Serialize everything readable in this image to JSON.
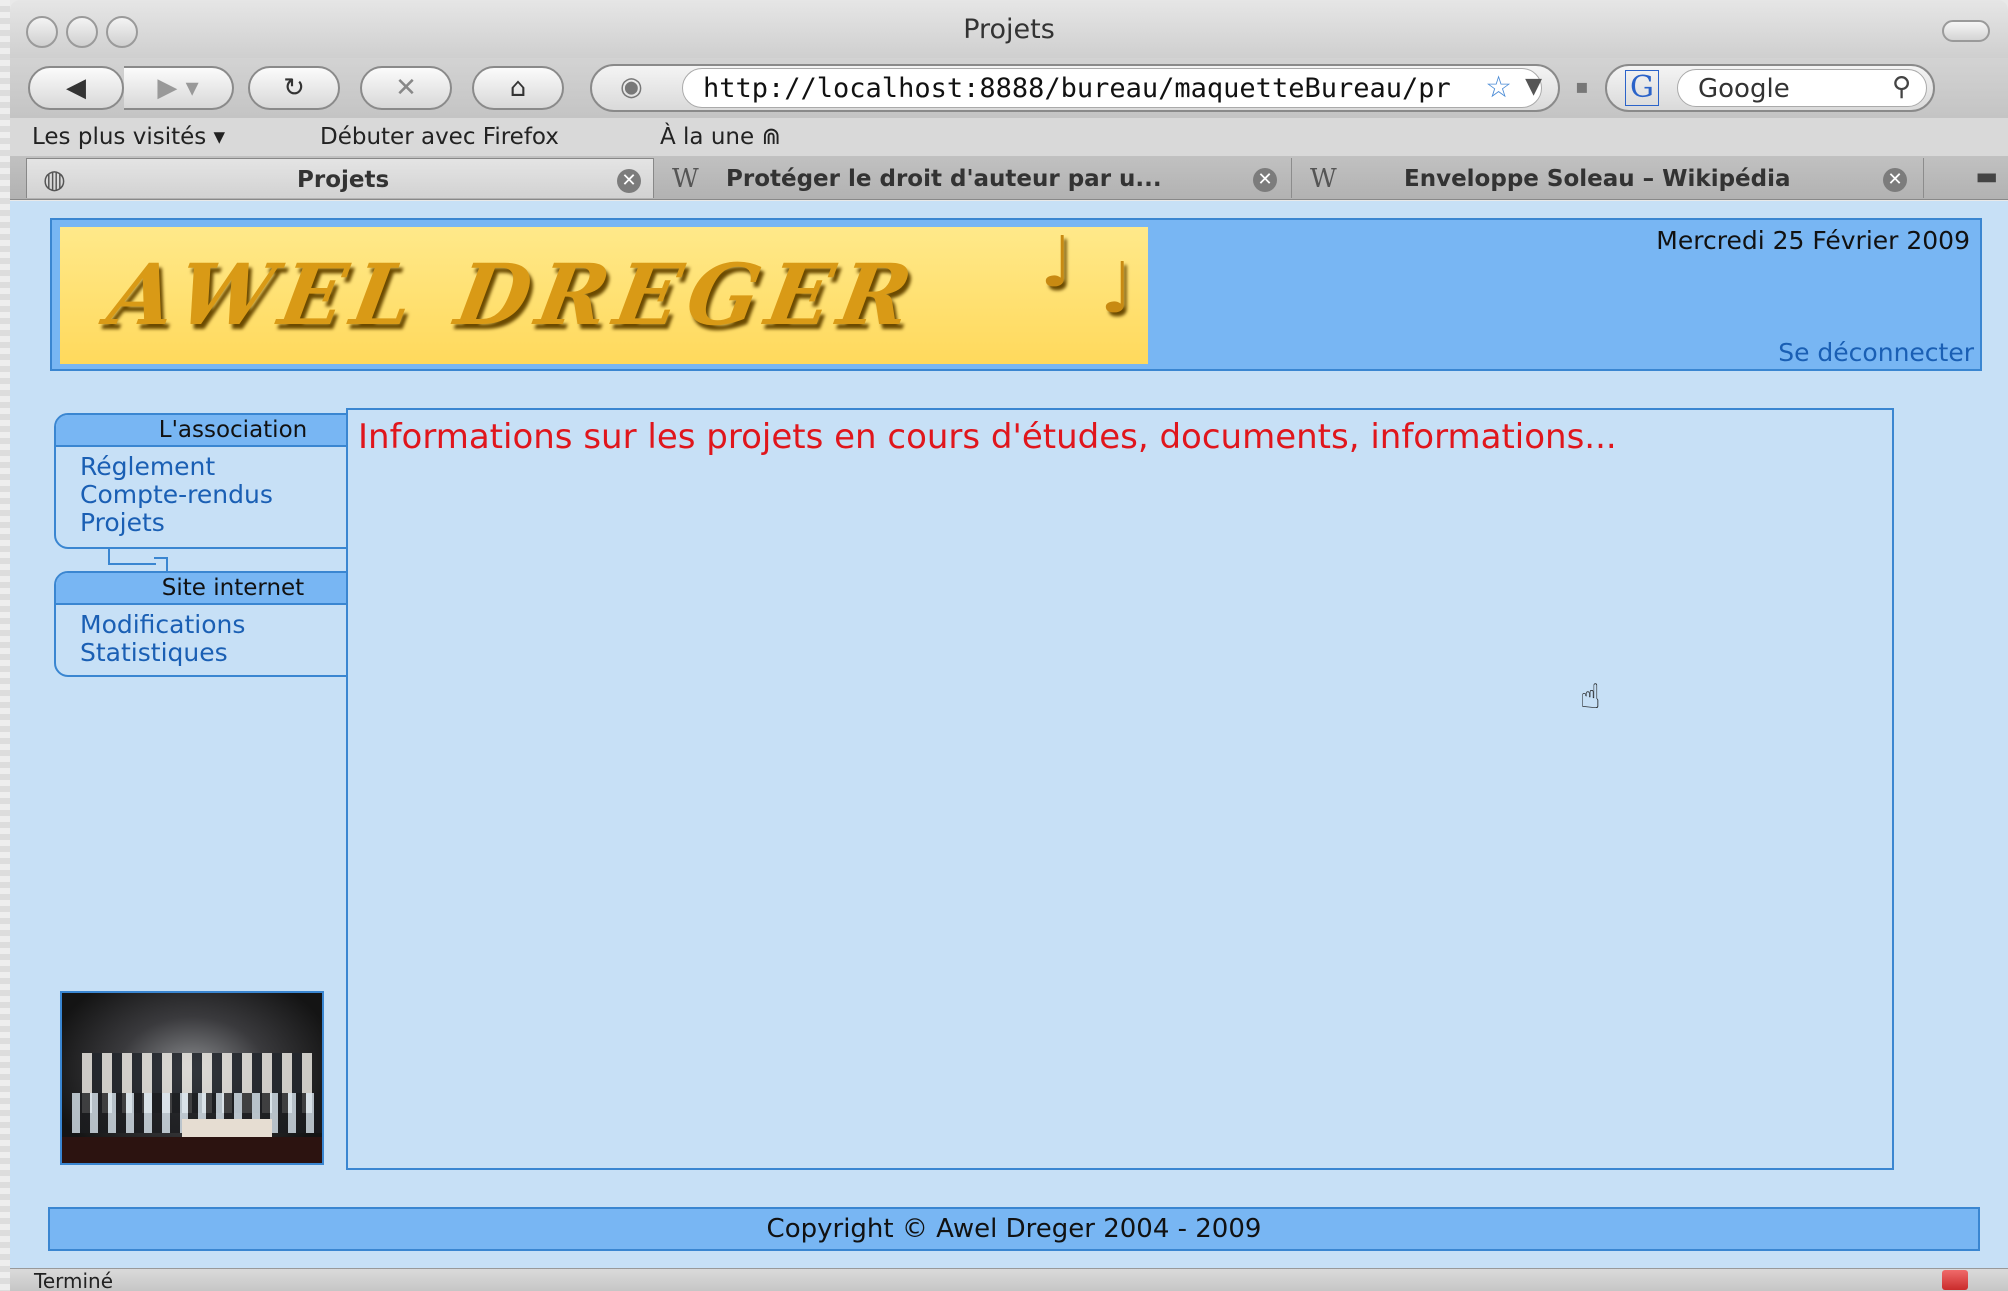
{
  "window": {
    "title": "Projets"
  },
  "toolbar": {
    "back_icon": "back-arrow-icon",
    "forward_icon": "forward-arrow-icon",
    "url": "http://localhost:8888/bureau/maquetteBureau/pr",
    "search_engine": "G",
    "search_placeholder": "Google"
  },
  "bookmarks": {
    "most_visited": "Les plus visités ▾",
    "getting_started": "Débuter avec Firefox",
    "news": "À la une ⋒"
  },
  "tabs": [
    {
      "label": "Projets",
      "icon": "globe-icon",
      "active": true
    },
    {
      "label": "Protéger le droit d'auteur par u...",
      "icon": "wikipedia-icon",
      "active": false
    },
    {
      "label": "Enveloppe Soleau – Wikipédia",
      "icon": "wikipedia-icon",
      "active": false
    }
  ],
  "header": {
    "logo_text": "AWEL DREGER",
    "date": "Mercredi 25 Février 2009",
    "logout": "Se déconnecter"
  },
  "sidebar": {
    "menus": [
      {
        "title": "L'association",
        "items": [
          "Réglement",
          "Compte-rendus",
          "Projets"
        ]
      },
      {
        "title": "Site internet",
        "items": [
          "Modifications",
          "Statistiques"
        ]
      }
    ]
  },
  "content": {
    "text": "Informations sur les projets en cours d'études, documents, informations..."
  },
  "footer": {
    "copyright": "Copyright © Awel Dreger 2004 - 2009"
  },
  "status": {
    "text": "Terminé"
  },
  "colors": {
    "page_bg": "#c7e0f6",
    "header_bg": "#78b6f3",
    "border": "#3a86d1",
    "link": "#1a5fb4",
    "content_text": "#e0161c",
    "logo_bg": "#ffe98a"
  }
}
